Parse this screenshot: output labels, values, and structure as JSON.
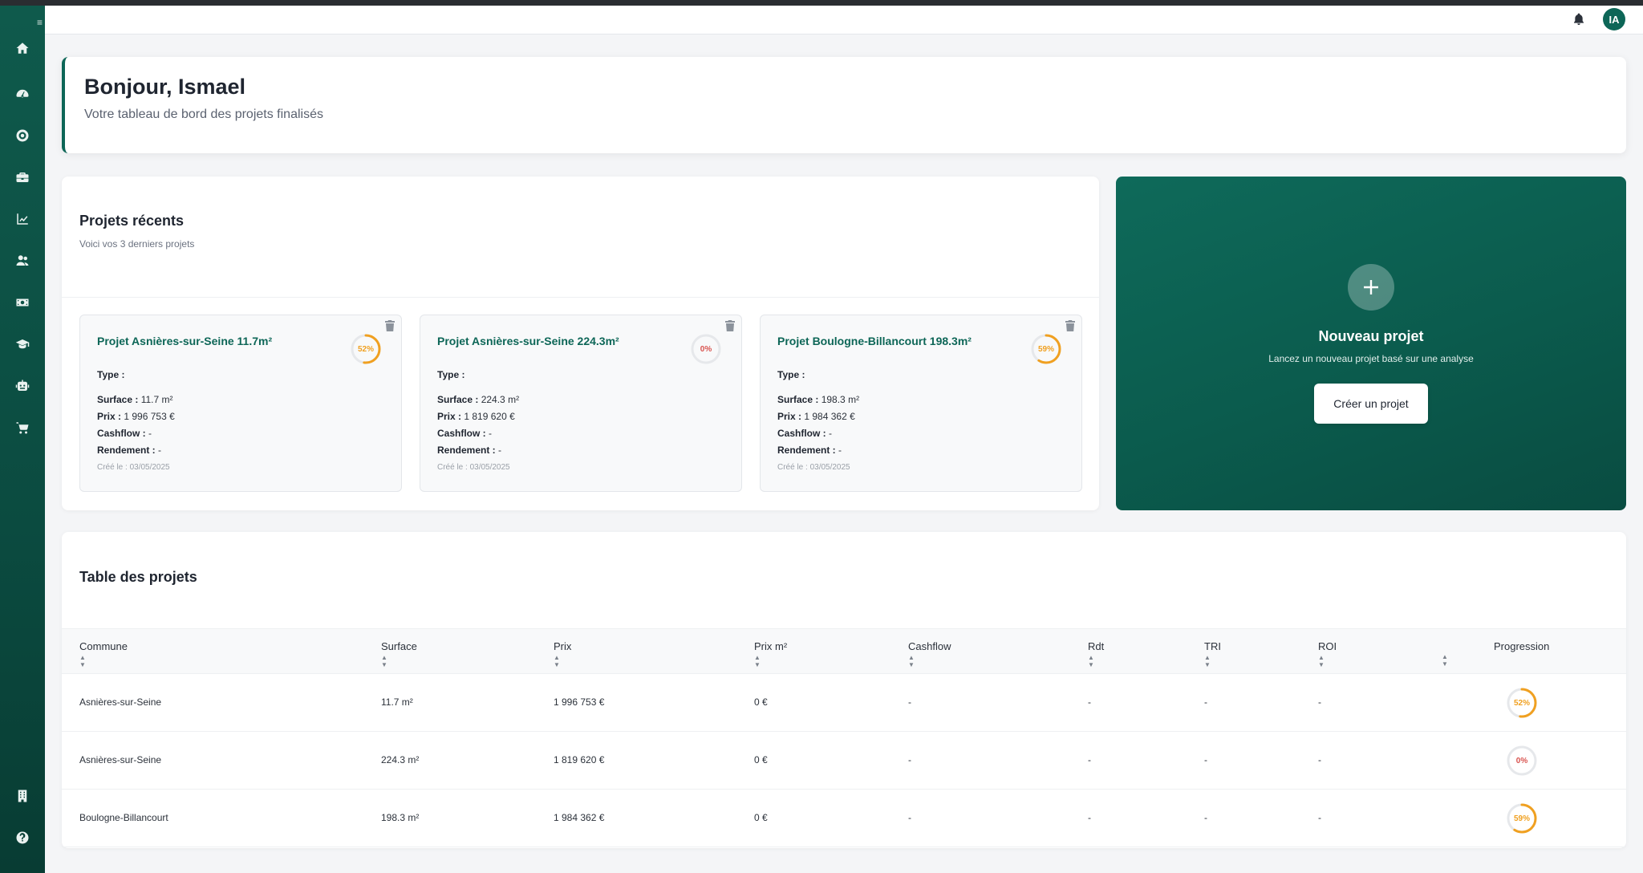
{
  "topbar": {
    "avatar_initials": "IA"
  },
  "welcome": {
    "title": "Bonjour, Ismael",
    "subtitle": "Votre tableau de bord des projets finalisés"
  },
  "recent": {
    "title": "Projets récents",
    "subtitle": "Voici vos 3 derniers projets",
    "labels": {
      "type": "Type :",
      "surface": "Surface :",
      "prix": "Prix :",
      "cashflow": "Cashflow :",
      "rendement": "Rendement :"
    },
    "cards": [
      {
        "title": "Projet Asnières-sur-Seine 11.7m²",
        "progress": 52,
        "progress_label": "52%",
        "type": "",
        "surface": "11.7 m²",
        "prix": "1 996 753 €",
        "cashflow": "-",
        "rendement": "-",
        "date": "Créé le : 03/05/2025"
      },
      {
        "title": "Projet Asnières-sur-Seine 224.3m²",
        "progress": 0,
        "progress_label": "0%",
        "type": "",
        "surface": "224.3 m²",
        "prix": "1 819 620 €",
        "cashflow": "-",
        "rendement": "-",
        "date": "Créé le : 03/05/2025"
      },
      {
        "title": "Projet Boulogne-Billancourt 198.3m²",
        "progress": 59,
        "progress_label": "59%",
        "type": "",
        "surface": "198.3 m²",
        "prix": "1 984 362 €",
        "cashflow": "-",
        "rendement": "-",
        "date": "Créé le : 03/05/2025"
      }
    ]
  },
  "new_project": {
    "title": "Nouveau projet",
    "subtitle": "Lancez un nouveau projet basé sur une analyse",
    "button": "Créer un projet"
  },
  "table": {
    "title": "Table des projets",
    "columns": [
      "Commune",
      "Surface",
      "Prix",
      "Prix m²",
      "Cashflow",
      "Rdt",
      "TRI",
      "ROI",
      "Progression"
    ],
    "rows": [
      {
        "commune": "Asnières-sur-Seine",
        "surface": "11.7 m²",
        "prix": "1 996 753 €",
        "prix_m2": "0 €",
        "cashflow": "-",
        "rdt": "-",
        "tri": "-",
        "roi": "-",
        "progress": 52,
        "progress_label": "52%"
      },
      {
        "commune": "Asnières-sur-Seine",
        "surface": "224.3 m²",
        "prix": "1 819 620 €",
        "prix_m2": "0 €",
        "cashflow": "-",
        "rdt": "-",
        "tri": "-",
        "roi": "-",
        "progress": 0,
        "progress_label": "0%"
      },
      {
        "commune": "Boulogne-Billancourt",
        "surface": "198.3 m²",
        "prix": "1 984 362 €",
        "prix_m2": "0 €",
        "cashflow": "-",
        "rdt": "-",
        "tri": "-",
        "roi": "-",
        "progress": 59,
        "progress_label": "59%"
      }
    ]
  },
  "colors": {
    "brand": "#0d6657",
    "progress_active": "#f0a020",
    "progress_zero": "#d9534f",
    "ring_track": "#e6e8eb"
  }
}
